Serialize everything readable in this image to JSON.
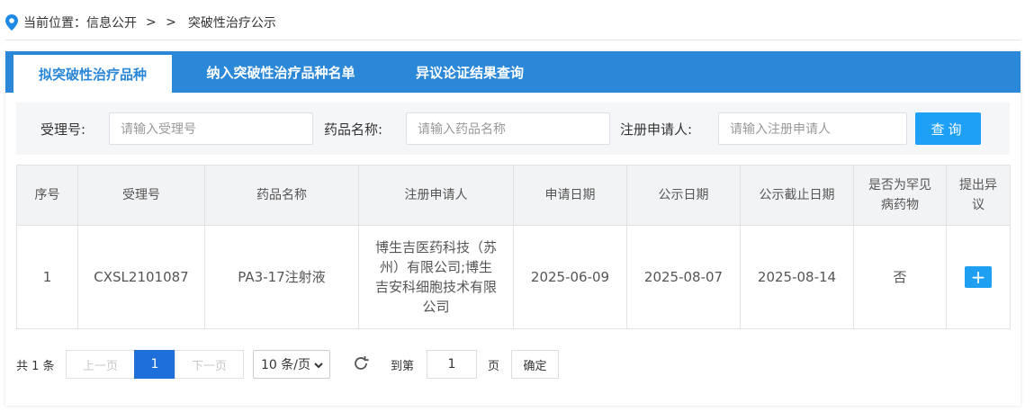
{
  "breadcrumb": {
    "prefix": "当前位置：信息公开",
    "separator": "> >",
    "current": "突破性治疗公示"
  },
  "tabs": [
    {
      "label": "拟突破性治疗品种",
      "active": true
    },
    {
      "label": "纳入突破性治疗品种名单",
      "active": false
    },
    {
      "label": "异议论证结果查询",
      "active": false
    }
  ],
  "search": {
    "accept_label": "受理号:",
    "accept_placeholder": "请输入受理号",
    "drug_label": "药品名称:",
    "drug_placeholder": "请输入药品名称",
    "applicant_label": "注册申请人:",
    "applicant_placeholder": "请输入注册申请人",
    "query_button": "查询"
  },
  "table": {
    "headers": [
      "序号",
      "受理号",
      "药品名称",
      "注册申请人",
      "申请日期",
      "公示日期",
      "公示截止日期",
      "是否为罕见病药物",
      "提出异议"
    ],
    "rows": [
      {
        "index": "1",
        "accept_no": "CXSL2101087",
        "drug_name": "PA3-17注射液",
        "applicant": "博生吉医药科技（苏州）有限公司;博生吉安科细胞技术有限公司",
        "apply_date": "2025-06-09",
        "publish_date": "2025-08-07",
        "deadline": "2025-08-14",
        "rare_disease": "否",
        "objection": "+"
      }
    ]
  },
  "pagination": {
    "total": "共 1 条",
    "prev": "上一页",
    "current_page": "1",
    "next": "下一页",
    "page_size": "10 条/页",
    "goto_label": "到第",
    "goto_value": "1",
    "page_suffix": "页",
    "confirm": "确定"
  },
  "colors": {
    "tab_bar": "#2b87d7",
    "primary_button": "#1ea0f7",
    "current_page": "#1e6fd9"
  }
}
